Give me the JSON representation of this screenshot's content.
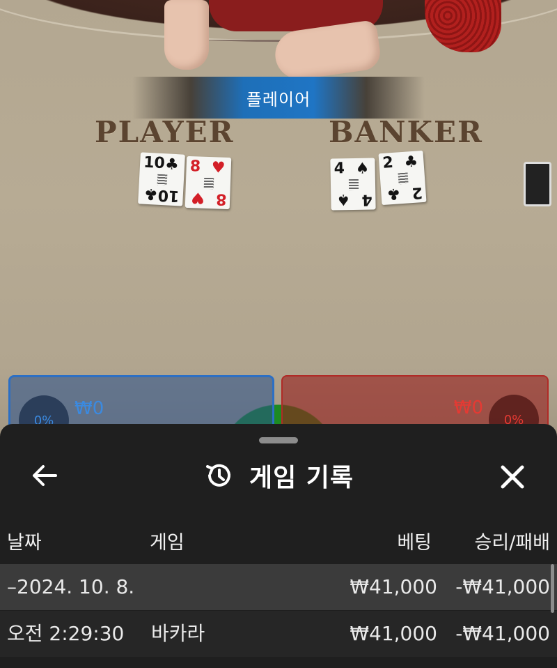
{
  "game_view": {
    "result_banner": "플레이어",
    "player_label": "PLAYER",
    "banker_label": "BANKER",
    "player_cards": [
      {
        "rank": "10",
        "suit": "♣",
        "color": "black"
      },
      {
        "rank": "8",
        "suit": "♥",
        "color": "red"
      }
    ],
    "banker_cards": [
      {
        "rank": "4",
        "suit": "♠",
        "color": "black"
      },
      {
        "rank": "2",
        "suit": "♣",
        "color": "black"
      }
    ],
    "player_spot": {
      "percent": "0%",
      "amount": "₩0",
      "accent": "#2c6fc4"
    },
    "banker_spot": {
      "percent": "0%",
      "amount": "₩0",
      "accent": "#b02a26"
    }
  },
  "sheet": {
    "title": "게임 기록",
    "icons": {
      "back": "arrow-left-icon",
      "history": "history-icon",
      "close": "close-icon"
    },
    "columns": {
      "date": "날짜",
      "game": "게임",
      "bet": "베팅",
      "result": "승리/패배"
    },
    "date_group": {
      "label": "–2024. 10. 8.",
      "bet": "₩41,000",
      "result": "-₩41,000"
    },
    "entries": [
      {
        "time": "오전 2:29:30",
        "game": "바카라",
        "bet": "₩41,000",
        "result": "-₩41,000"
      }
    ]
  }
}
